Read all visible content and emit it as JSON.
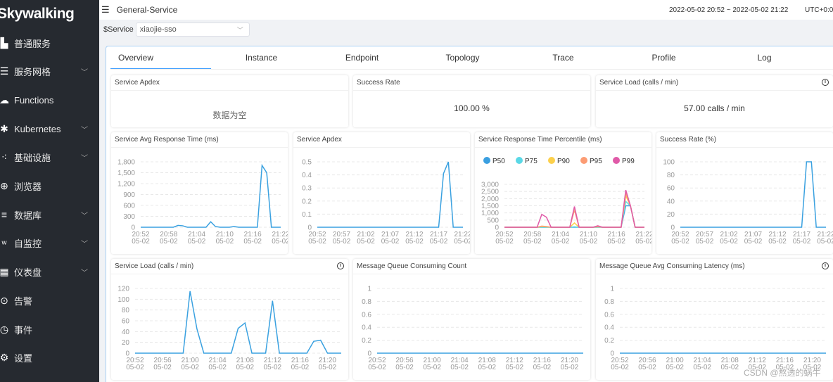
{
  "app": {
    "logo": "Skywalking",
    "colors": {
      "sidebar": "#262a30",
      "accent": "#409eff",
      "line": "#3aa1e0"
    }
  },
  "sidebar": {
    "items": [
      {
        "label": "普通服务",
        "icon": "bar-chart-icon",
        "expandable": false
      },
      {
        "label": "服务网格",
        "icon": "mesh-icon",
        "expandable": true
      },
      {
        "label": "Functions",
        "icon": "cloud-icon",
        "expandable": false
      },
      {
        "label": "Kubernetes",
        "icon": "kubernetes-icon",
        "expandable": true
      },
      {
        "label": "基础设施",
        "icon": "infrastructure-icon",
        "expandable": true
      },
      {
        "label": "浏览器",
        "icon": "globe-icon",
        "expandable": false
      },
      {
        "label": "数据库",
        "icon": "database-icon",
        "expandable": true
      },
      {
        "label": "自监控",
        "icon": "sw-icon",
        "expandable": true
      },
      {
        "label": "仪表盘",
        "icon": "dashboard-icon",
        "expandable": true
      },
      {
        "label": "告警",
        "icon": "alert-icon",
        "expandable": false
      },
      {
        "label": "事件",
        "icon": "event-icon",
        "expandable": false
      },
      {
        "label": "设置",
        "icon": "gear-icon",
        "expandable": false
      }
    ]
  },
  "header": {
    "title": "General-Service",
    "time_range": "2022-05-02 20:52 ~ 2022-05-02 21:22",
    "timezone": "UTC+0:0"
  },
  "filter": {
    "label": "$Service",
    "value": "xiaojie-sso"
  },
  "tabs": [
    {
      "label": "Overview",
      "active": true
    },
    {
      "label": "Instance"
    },
    {
      "label": "Endpoint"
    },
    {
      "label": "Topology"
    },
    {
      "label": "Trace"
    },
    {
      "label": "Profile"
    },
    {
      "label": "Log"
    }
  ],
  "cards": [
    {
      "title": "Service Apdex",
      "value": "数据为空"
    },
    {
      "title": "Success Rate",
      "value": "100.00 %"
    },
    {
      "title": "Service Load (calls / min)",
      "value": "57.00 calls / min",
      "info": true
    }
  ],
  "chart_data": [
    {
      "type": "line",
      "title": "Service Avg Response Time (ms)",
      "ylim": [
        0,
        1800
      ],
      "yticks": [
        "0",
        "300",
        "600",
        "900",
        "1,200",
        "1,500",
        "1,800"
      ],
      "xticks": [
        "20:52",
        "20:58",
        "21:04",
        "21:10",
        "21:16",
        "21:22"
      ],
      "tick_date": "05-02",
      "x_start": "20:52",
      "x_end": "21:22",
      "series": [
        {
          "values": [
            0,
            0,
            0,
            0,
            0,
            0,
            0,
            0,
            50,
            40,
            0,
            0,
            0,
            0,
            0,
            150,
            20,
            0,
            0,
            0,
            20,
            0,
            0,
            0,
            0,
            0,
            1700,
            1500,
            0,
            0,
            0
          ]
        }
      ]
    },
    {
      "type": "line",
      "title": "Service Apdex",
      "ylim": [
        0,
        0.5
      ],
      "yticks": [
        "0",
        "0.1",
        "0.2",
        "0.3",
        "0.4",
        "0.5"
      ],
      "xticks": [
        "20:52",
        "20:57",
        "21:02",
        "21:07",
        "21:12",
        "21:17",
        "21:22"
      ],
      "tick_date": "05-02",
      "x_start": "20:52",
      "x_end": "21:22",
      "series": [
        {
          "values": [
            0,
            0,
            0,
            0,
            0,
            0,
            0,
            0,
            0,
            0,
            0,
            0,
            0,
            0,
            0,
            0,
            0,
            0,
            0,
            0,
            0,
            0,
            0,
            0,
            0,
            0,
            0.41,
            0.5,
            0,
            0,
            0
          ]
        }
      ]
    },
    {
      "type": "line",
      "title": "Service Response Time Percentile (ms)",
      "legend": "top-left",
      "ylim": [
        0,
        3000
      ],
      "yticks": [
        "0",
        "500",
        "1,000",
        "1,500",
        "2,000",
        "2,500",
        "3,000"
      ],
      "xticks": [
        "20:52",
        "20:58",
        "21:04",
        "21:10",
        "21:16",
        "21:22"
      ],
      "tick_date": "05-02",
      "x_start": "20:52",
      "x_end": "21:22",
      "series": [
        {
          "name": "P50",
          "color": "#3a9fe0",
          "values": [
            0,
            0,
            0,
            0,
            0,
            0,
            0,
            0,
            0,
            0,
            0,
            0,
            0,
            0,
            0,
            0,
            0,
            0,
            0,
            0,
            0,
            0,
            0,
            0,
            0,
            0,
            1500,
            1500,
            0,
            0,
            0
          ]
        },
        {
          "name": "P75",
          "color": "#5ad8e6",
          "values": [
            0,
            0,
            0,
            0,
            0,
            0,
            0,
            0,
            0,
            0,
            0,
            0,
            0,
            0,
            0,
            30,
            0,
            0,
            0,
            0,
            0,
            0,
            0,
            0,
            0,
            0,
            1800,
            1500,
            0,
            0,
            0
          ]
        },
        {
          "name": "P90",
          "color": "#fcd04b",
          "values": [
            0,
            0,
            0,
            0,
            0,
            0,
            0,
            0,
            50,
            30,
            0,
            0,
            0,
            0,
            0,
            300,
            0,
            0,
            0,
            0,
            30,
            0,
            0,
            0,
            0,
            0,
            2200,
            1500,
            0,
            0,
            0
          ]
        },
        {
          "name": "P95",
          "color": "#fc9c74",
          "values": [
            0,
            0,
            0,
            0,
            0,
            0,
            0,
            0,
            80,
            50,
            0,
            0,
            0,
            0,
            0,
            1200,
            0,
            0,
            0,
            0,
            50,
            0,
            0,
            0,
            0,
            0,
            2400,
            1500,
            0,
            0,
            0
          ]
        },
        {
          "name": "P99",
          "color": "#e05aa8",
          "values": [
            0,
            0,
            0,
            0,
            0,
            0,
            0,
            0,
            900,
            700,
            0,
            0,
            0,
            0,
            0,
            1450,
            0,
            0,
            0,
            0,
            100,
            0,
            0,
            0,
            0,
            0,
            2600,
            1500,
            0,
            0,
            0
          ]
        }
      ]
    },
    {
      "type": "line",
      "title": "Success Rate (%)",
      "ylim": [
        0,
        100
      ],
      "yticks": [
        "0",
        "20",
        "40",
        "60",
        "80",
        "100"
      ],
      "xticks": [
        "20:52",
        "20:57",
        "21:02",
        "21:07",
        "21:12",
        "21:17",
        "21:22"
      ],
      "tick_date": "05-02",
      "x_start": "20:52",
      "x_end": "21:22",
      "series": [
        {
          "values": [
            0,
            0,
            0,
            0,
            0,
            0,
            0,
            0,
            0,
            0,
            0,
            0,
            0,
            0,
            0,
            0,
            0,
            0,
            0,
            0,
            0,
            0,
            0,
            0,
            0,
            0,
            100,
            100,
            0,
            0,
            0
          ]
        }
      ]
    },
    {
      "type": "line",
      "title": "Service Load (calls / min)",
      "info": true,
      "ylim": [
        0,
        120
      ],
      "yticks": [
        "0",
        "20",
        "40",
        "60",
        "80",
        "100",
        "120"
      ],
      "xticks": [
        "20:52",
        "20:56",
        "21:00",
        "21:04",
        "21:08",
        "21:12",
        "21:16",
        "21:20"
      ],
      "tick_date": "05-02",
      "x_start": "20:52",
      "x_end": "21:22",
      "series": [
        {
          "values": [
            0,
            0,
            0,
            0,
            0,
            0,
            0,
            0,
            115,
            45,
            0,
            0,
            0,
            0,
            0,
            46,
            56,
            0,
            0,
            0,
            97,
            0,
            0,
            0,
            0,
            0,
            22,
            24,
            0,
            0,
            0
          ]
        }
      ]
    },
    {
      "type": "line",
      "title": "Message Queue Consuming Count",
      "ylim": [
        0,
        1
      ],
      "yticks": [
        "0",
        "0.2",
        "0.4",
        "0.6",
        "0.8",
        "1"
      ],
      "xticks": [
        "20:52",
        "20:56",
        "21:00",
        "21:04",
        "21:08",
        "21:12",
        "21:16",
        "21:20"
      ],
      "tick_date": "05-02",
      "x_start": "20:52",
      "x_end": "21:22",
      "series": [
        {
          "values": [
            0,
            0,
            0,
            0,
            0,
            0,
            0,
            0,
            0,
            0,
            0,
            0,
            0,
            0,
            0,
            0,
            0,
            0,
            0,
            0,
            0,
            0,
            0,
            0,
            0,
            0,
            0,
            0,
            0,
            0,
            0
          ]
        }
      ]
    },
    {
      "type": "line",
      "title": "Message Queue Avg Consuming Latency (ms)",
      "info": true,
      "ylim": [
        0,
        1
      ],
      "yticks": [
        "0",
        "0.2",
        "0.4",
        "0.6",
        "0.8",
        "1"
      ],
      "xticks": [
        "20:52",
        "20:56",
        "21:00",
        "21:04",
        "21:08",
        "21:12",
        "21:16",
        "21:20"
      ],
      "tick_date": "05-02",
      "x_start": "20:52",
      "x_end": "21:22",
      "series": [
        {
          "values": [
            0,
            0,
            0,
            0,
            0,
            0,
            0,
            0,
            0,
            0,
            0,
            0,
            0,
            0,
            0,
            0,
            0,
            0,
            0,
            0,
            0,
            0,
            0,
            0,
            0,
            0,
            0,
            0,
            0,
            0,
            0
          ]
        }
      ]
    }
  ],
  "watermark": "CSDN @熬透的蜗牛"
}
